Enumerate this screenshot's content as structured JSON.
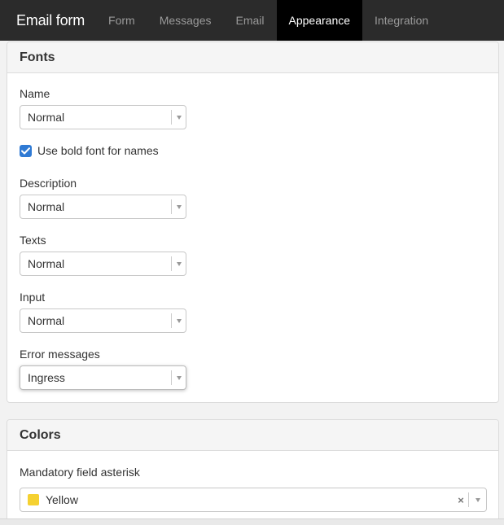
{
  "navbar": {
    "brand": "Email form",
    "tabs": [
      {
        "label": "Form",
        "active": false
      },
      {
        "label": "Messages",
        "active": false
      },
      {
        "label": "Email",
        "active": false
      },
      {
        "label": "Appearance",
        "active": true
      },
      {
        "label": "Integration",
        "active": false
      }
    ]
  },
  "fonts": {
    "heading": "Fonts",
    "name": {
      "label": "Name",
      "value": "Normal"
    },
    "bold_names": {
      "label": "Use bold font for names",
      "checked": true
    },
    "description": {
      "label": "Description",
      "value": "Normal"
    },
    "texts": {
      "label": "Texts",
      "value": "Normal"
    },
    "input": {
      "label": "Input",
      "value": "Normal"
    },
    "error_messages": {
      "label": "Error messages",
      "value": "Ingress"
    }
  },
  "colors": {
    "heading": "Colors",
    "asterisk": {
      "label": "Mandatory field asterisk",
      "value": "Yellow",
      "swatch": "#f5d131"
    }
  },
  "icons": {
    "checkbox": "check-icon",
    "dropdown": "chevron-down-icon",
    "clear": "close-icon"
  },
  "theme": {
    "navbar_bg": "#2b2b2b",
    "active_tab_bg": "#000000",
    "checkbox_blue": "#2f7ad4"
  }
}
